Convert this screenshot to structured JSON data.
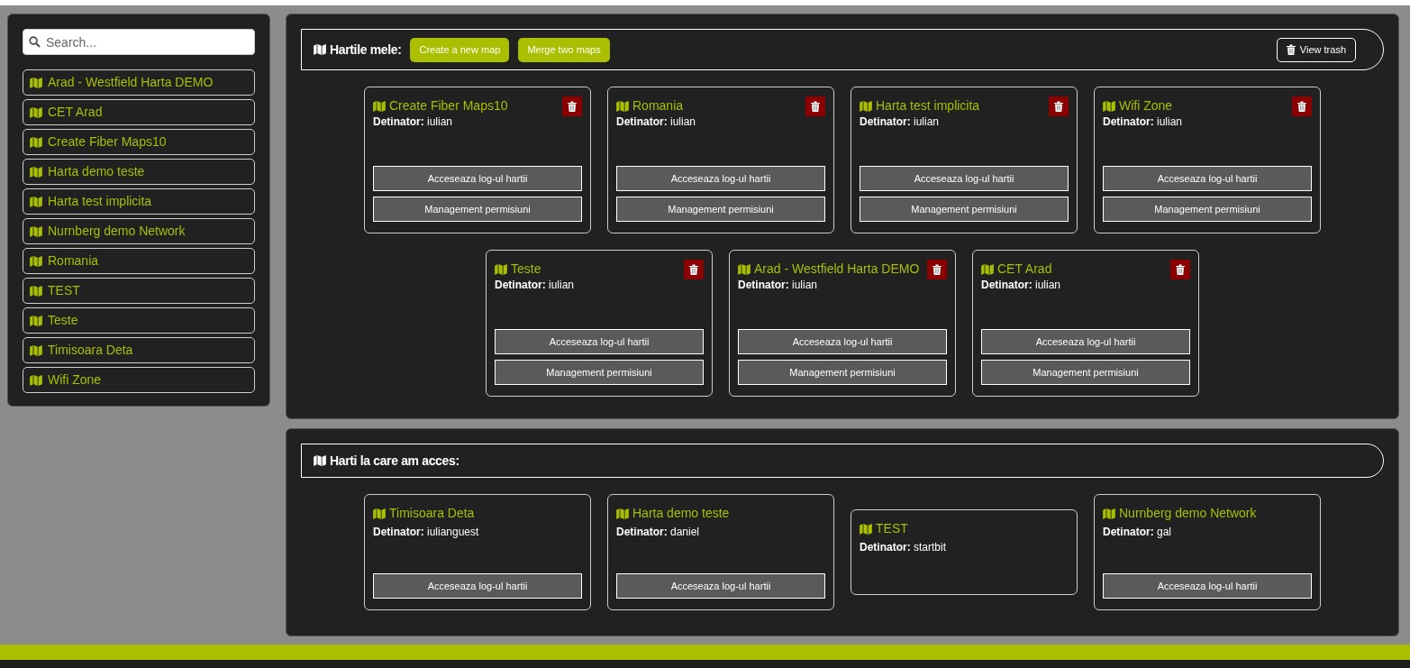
{
  "sidebar": {
    "search": {
      "placeholder": "Search..."
    },
    "items": [
      {
        "label": "Arad - Westfield Harta DEMO"
      },
      {
        "label": "CET Arad"
      },
      {
        "label": "Create Fiber Maps10"
      },
      {
        "label": "Harta demo teste"
      },
      {
        "label": "Harta test implicita"
      },
      {
        "label": "Nurnberg demo Network"
      },
      {
        "label": "Romania"
      },
      {
        "label": "TEST"
      },
      {
        "label": "Teste"
      },
      {
        "label": "Timisoara Deta"
      },
      {
        "label": "Wifi Zone"
      }
    ]
  },
  "sections": [
    {
      "title": "Hartile mele:",
      "buttons": [
        "Create a new map",
        "Merge two maps"
      ],
      "trash_button": "View trash",
      "cards": [
        {
          "title": "Create Fiber Maps10",
          "owner": "**Detinator:** iulian",
          "deletable": true,
          "buttons": [
            "Acceseaza log-ul hartii",
            "Management permisiuni"
          ]
        },
        {
          "title": "Romania",
          "owner": "**Detinator:** iulian",
          "deletable": true,
          "buttons": [
            "Acceseaza log-ul hartii",
            "Management permisiuni"
          ]
        },
        {
          "title": "Harta test implicita",
          "owner": "**Detinator:** iulian",
          "deletable": true,
          "buttons": [
            "Acceseaza log-ul hartii",
            "Management permisiuni"
          ]
        },
        {
          "title": "Wifi Zone",
          "owner": "**Detinator:** iulian",
          "deletable": true,
          "buttons": [
            "Acceseaza log-ul hartii",
            "Management permisiuni"
          ]
        },
        {
          "title": "Teste",
          "owner": "**Detinator:** iulian",
          "deletable": true,
          "buttons": [
            "Acceseaza log-ul hartii",
            "Management permisiuni"
          ]
        },
        {
          "title": "Arad - Westfield Harta DEMO",
          "owner": "**Detinator:** iulian",
          "deletable": true,
          "buttons": [
            "Acceseaza log-ul hartii",
            "Management permisiuni"
          ]
        },
        {
          "title": "CET Arad",
          "owner": "**Detinator:** iulian",
          "deletable": true,
          "buttons": [
            "Acceseaza log-ul hartii",
            "Management permisiuni"
          ]
        }
      ]
    },
    {
      "title": "Harti la care am acces:",
      "cards": [
        {
          "title": "Timisoara Deta",
          "owner": "**Detinator:** iulianguest",
          "deletable": false,
          "buttons": [
            "Acceseaza log-ul hartii"
          ]
        },
        {
          "title": "Harta demo teste",
          "owner": "**Detinator:** daniel",
          "deletable": false,
          "buttons": [
            "Acceseaza log-ul hartii"
          ]
        },
        {
          "title": "TEST",
          "owner": "**Detinator:** startbit",
          "deletable": false
        },
        {
          "title": "Nurnberg demo Network",
          "owner": "**Detinator:** gal",
          "deletable": false,
          "buttons": [
            "Acceseaza log-ul hartii"
          ]
        }
      ]
    }
  ]
}
